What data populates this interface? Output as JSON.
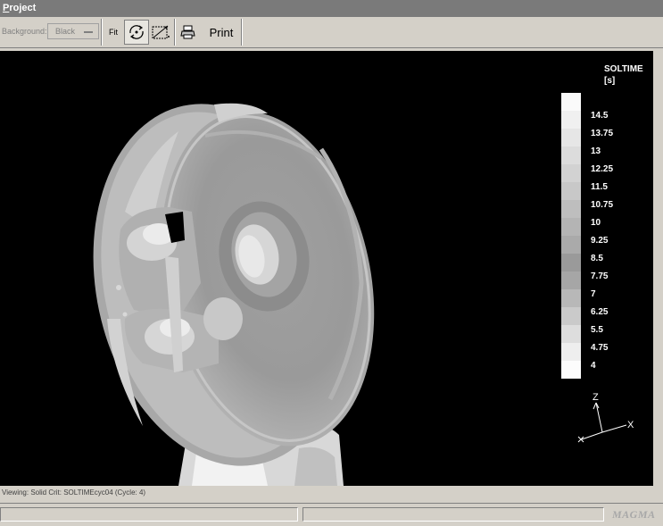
{
  "window": {
    "title_first": "P",
    "title_rest": "roject"
  },
  "toolbar": {
    "background_label": "Background:",
    "background_value": "Black",
    "fit_label": "Fit",
    "print_label": "Print",
    "icons": [
      "rotate-icon",
      "zoom-window-icon",
      "printer-icon"
    ]
  },
  "legend": {
    "title": "SOLTIME",
    "unit": "[s]",
    "labels": [
      "14.5",
      "13.75",
      "13",
      "12.25",
      "11.5",
      "10.75",
      "10",
      "9.25",
      "8.5",
      "7.75",
      "7",
      "6.25",
      "5.5",
      "4.75",
      "4"
    ],
    "colors": [
      "#fafafa",
      "#f0f0f0",
      "#e6e6e6",
      "#dcdcdc",
      "#d2d2d2",
      "#c8c8c8",
      "#bebebe",
      "#b4b4b4",
      "#aaaaaa",
      "#9a9a9a",
      "#a6a6a6",
      "#b8b8b8",
      "#cacaca",
      "#dddddd",
      "#eeeeee",
      "#fcfcfc"
    ]
  },
  "axes": {
    "z": "Z",
    "x": "X"
  },
  "status": {
    "viewing": "Viewing: Solid Crit: SOLTIMEcyc04 (Cycle: 4)",
    "logo": "MAGMA"
  }
}
